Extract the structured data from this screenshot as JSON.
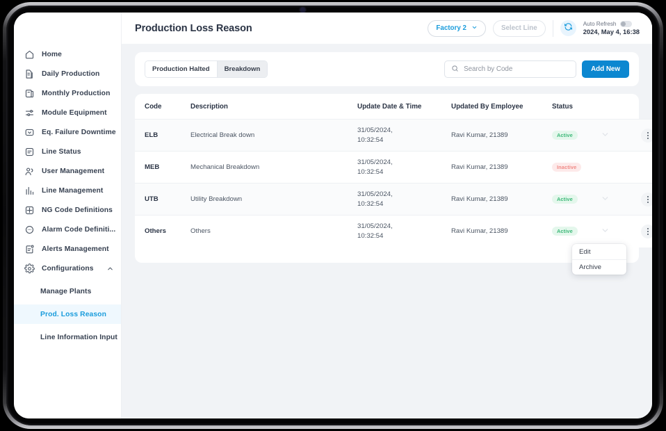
{
  "header": {
    "title": "Production Loss Reason",
    "factory_selector": "Factory 2",
    "line_selector": "Select Line",
    "auto_refresh_label": "Auto Refresh",
    "last_refresh": "2024, May 4, 16:38",
    "refresh_icon": "refresh-icon",
    "chevron_icon": "chevron-down-icon"
  },
  "sidebar": {
    "items": [
      {
        "label": "Home",
        "icon": "home-icon"
      },
      {
        "label": "Daily Production",
        "icon": "daily-production-icon"
      },
      {
        "label": "Monthly Production",
        "icon": "monthly-production-icon"
      },
      {
        "label": "Module Equipment",
        "icon": "sliders-icon"
      },
      {
        "label": "Eq. Failure Downtime",
        "icon": "failure-downtime-icon"
      },
      {
        "label": "Line Status",
        "icon": "line-status-icon"
      },
      {
        "label": "User Management",
        "icon": "users-icon"
      },
      {
        "label": "Line Management",
        "icon": "bar-chart-icon"
      },
      {
        "label": "NG Code Definitions",
        "icon": "grid-icon"
      },
      {
        "label": "Alarm Code Definiti...",
        "icon": "alarm-code-icon"
      },
      {
        "label": "Alerts Management",
        "icon": "alerts-icon"
      },
      {
        "label": "Configurations",
        "icon": "gear-icon",
        "expanded": true
      }
    ],
    "sub_items": [
      {
        "label": "Manage Plants",
        "active": false
      },
      {
        "label": "Prod. Loss Reason",
        "active": true
      },
      {
        "label": "Line Information Input",
        "active": false
      }
    ]
  },
  "toolbar": {
    "tabs": [
      {
        "label": "Production Halted",
        "active": false
      },
      {
        "label": "Breakdown",
        "active": true
      }
    ],
    "search_placeholder": "Search by Code",
    "search_value": "",
    "search_icon": "search-icon",
    "add_new_label": "Add New"
  },
  "table": {
    "columns": [
      "Code",
      "Description",
      "Update Date & Time",
      "Updated By Employee",
      "Status"
    ],
    "rows": [
      {
        "code": "ELB",
        "description": "Electrical Break down",
        "date": "31/05/2024,",
        "time": "10:32:54",
        "employee": "Ravi Kumar, 21389",
        "status": "Active",
        "status_kind": "active"
      },
      {
        "code": "MEB",
        "description": "Mechanical Breakdown",
        "date": "31/05/2024,",
        "time": "10:32:54",
        "employee": "Ravi Kumar, 21389",
        "status": "Inactive",
        "status_kind": "inactive"
      },
      {
        "code": "UTB",
        "description": "Utility Breakdown",
        "date": "31/05/2024,",
        "time": "10:32:54",
        "employee": "Ravi Kumar, 21389",
        "status": "Active",
        "status_kind": "active"
      },
      {
        "code": "Others",
        "description": "Others",
        "date": "31/05/2024,",
        "time": "10:32:54",
        "employee": "Ravi Kumar, 21389",
        "status": "Active",
        "status_kind": "active"
      }
    ]
  },
  "context_menu": {
    "items": [
      "Edit",
      "Archive"
    ]
  },
  "colors": {
    "accent": "#0c87d0",
    "accent_light": "#1a9cdc",
    "status_active_bg": "#e4f7ec",
    "status_active_fg": "#3cb878",
    "status_inactive_bg": "#fdeaea",
    "status_inactive_fg": "#f08a86",
    "page_bg": "#f1f3f6",
    "text_dark": "#2b3445"
  }
}
